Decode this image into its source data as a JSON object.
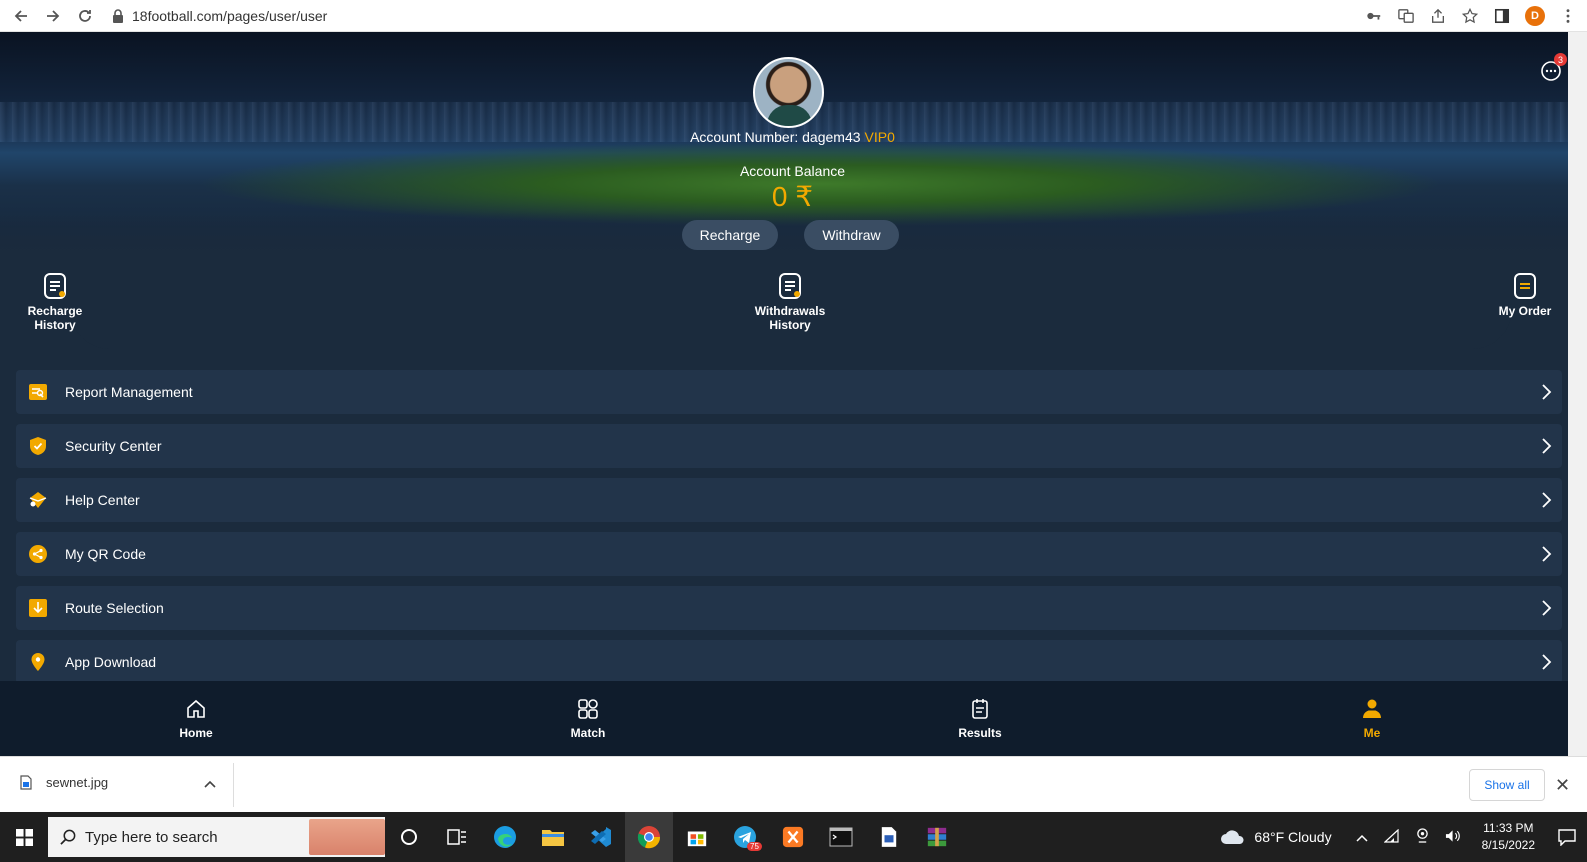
{
  "browser": {
    "url": "18football.com/pages/user/user",
    "profile_initial": "D"
  },
  "header": {
    "account_label": "Account Number: dagem43",
    "vip": "VIP0",
    "balance_label": "Account Balance",
    "balance_value": "0 ₹",
    "recharge_label": "Recharge",
    "withdraw_label": "Withdraw",
    "chat_badge": "3"
  },
  "quick_links": [
    {
      "line1": "Recharge",
      "line2": "History"
    },
    {
      "line1": "Withdrawals",
      "line2": "History"
    },
    {
      "line1": "",
      "line2": "My Order"
    }
  ],
  "menu": [
    {
      "label": "Report Management",
      "icon": "report-icon"
    },
    {
      "label": "Security Center",
      "icon": "shield-icon"
    },
    {
      "label": "Help Center",
      "icon": "help-icon"
    },
    {
      "label": "My QR Code",
      "icon": "share-icon"
    },
    {
      "label": "Route Selection",
      "icon": "download-arrow-icon"
    },
    {
      "label": "App Download",
      "icon": "location-pin-icon"
    }
  ],
  "bottom_nav": [
    {
      "label": "Home"
    },
    {
      "label": "Match"
    },
    {
      "label": "Results"
    },
    {
      "label": "Me"
    }
  ],
  "colors": {
    "accent": "#f2a900",
    "background": "#1b2b3d",
    "row": "#22344a",
    "nav": "#0f1c2c"
  },
  "downloads": {
    "file_name": "sewnet.jpg",
    "show_all": "Show all"
  },
  "taskbar": {
    "search_placeholder": "Type here to search",
    "telegram_badge": "75",
    "weather": "68°F  Cloudy",
    "time": "11:33 PM",
    "date": "8/15/2022"
  }
}
